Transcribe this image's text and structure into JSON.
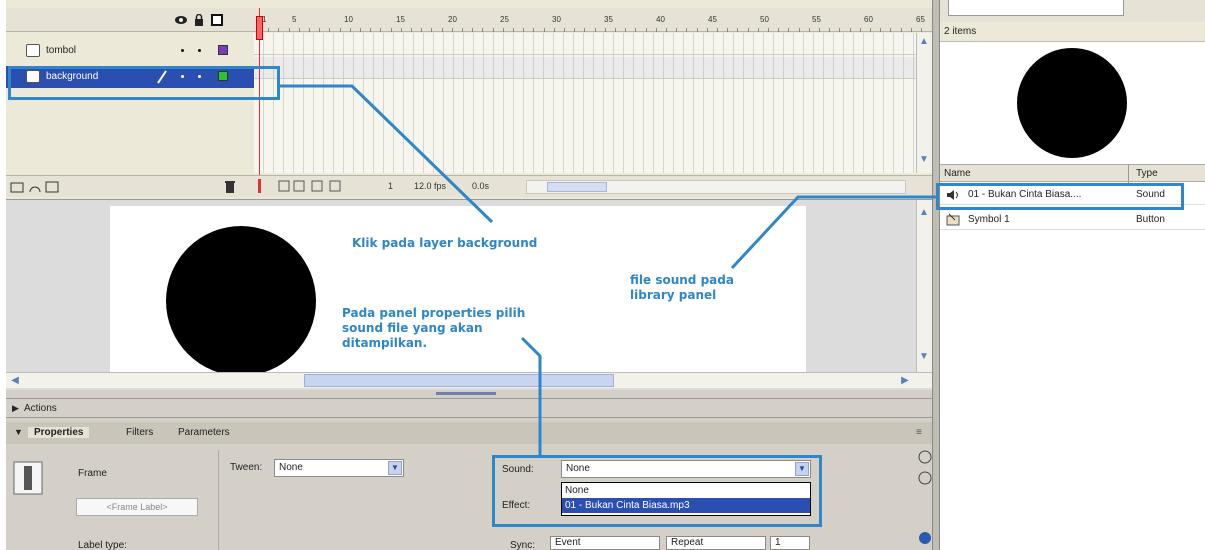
{
  "timeline": {
    "ruler_numbers": [
      "1",
      "5",
      "10",
      "15",
      "20",
      "25",
      "30",
      "35",
      "40",
      "45",
      "50",
      "55",
      "60",
      "65"
    ],
    "layers": [
      {
        "name": "tombol",
        "color": "#7a3fb8"
      },
      {
        "name": "background",
        "color": "#2ec42e"
      }
    ],
    "footer": {
      "frame": "1",
      "fps": "12.0 fps",
      "time": "0.0s"
    }
  },
  "panels": {
    "actions_label": "Actions",
    "tabs": [
      "Properties",
      "Filters",
      "Parameters"
    ]
  },
  "properties": {
    "frame_label": "Frame",
    "frame_label_placeholder": "<Frame Label>",
    "label_type_label": "Label type:",
    "tween_label": "Tween:",
    "tween_value": "None",
    "sound_label": "Sound:",
    "sound_value": "None",
    "effect_label": "Effect:",
    "sound_options": [
      "None",
      "01 - Bukan Cinta Biasa.mp3"
    ],
    "sync_label": "Sync:",
    "sync_value": "Event",
    "repeat_value": "Repeat",
    "repeat_count": "1"
  },
  "library": {
    "count": "2 items",
    "columns": {
      "name": "Name",
      "type": "Type"
    },
    "items": [
      {
        "name": "01 - Bukan Cinta Biasa....",
        "type": "Sound",
        "icon": "speaker-icon"
      },
      {
        "name": "Symbol 1",
        "type": "Button",
        "icon": "button-symbol-icon"
      }
    ]
  },
  "annotations": {
    "layer_note": "Klik pada layer background",
    "library_note": "file sound pada\nlibrary panel",
    "properties_note": "Pada panel properties pilih\nsound file yang akan\nditampilkan."
  },
  "colors": {
    "annotation": "#2f86c8",
    "selected_layer": "#2a4fb0",
    "playhead": "#d33333"
  }
}
